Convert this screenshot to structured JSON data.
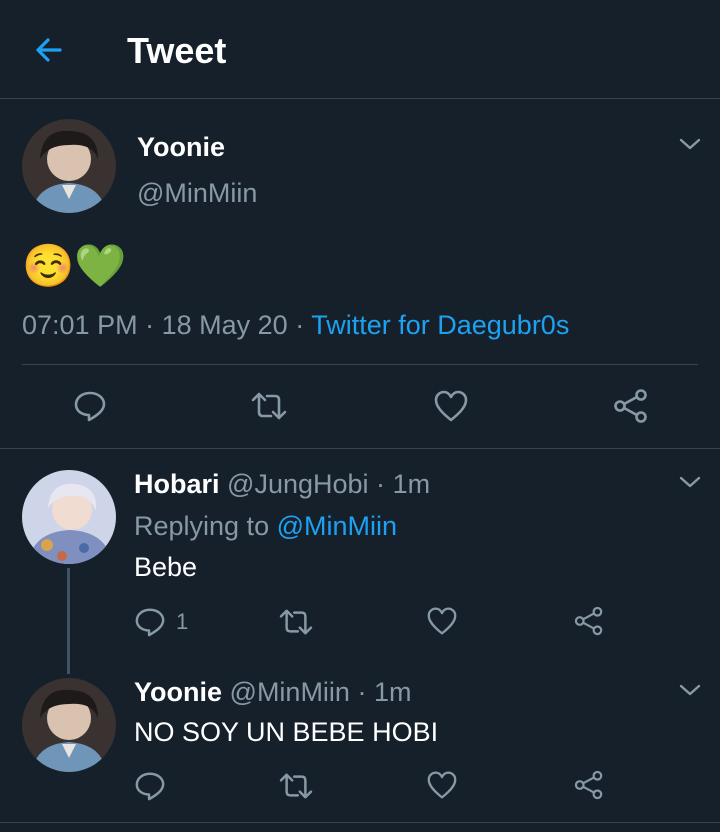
{
  "header": {
    "title": "Tweet"
  },
  "main_tweet": {
    "display_name": "Yoonie",
    "handle": "@MinMiin",
    "text": "☺️💚",
    "time": "07:01 PM",
    "sep1": "·",
    "date": "18 May 20",
    "sep2": "·",
    "client": "Twitter for Daegubr0s"
  },
  "replies": [
    {
      "display_name": "Hobari",
      "handle": "@JungHobi",
      "sep": "·",
      "age": "1m",
      "replying_prefix": "Replying to",
      "replying_handle": "@MinMiin",
      "text": "Bebe",
      "reply_count": "1"
    },
    {
      "display_name": "Yoonie",
      "handle": "@MinMiin",
      "sep": "·",
      "age": "1m",
      "text": "NO SOY UN BEBE HOBI"
    }
  ],
  "colors": {
    "background": "#15202b",
    "accent": "#1da1f2",
    "muted": "#8899a6",
    "divider": "#38444d"
  }
}
